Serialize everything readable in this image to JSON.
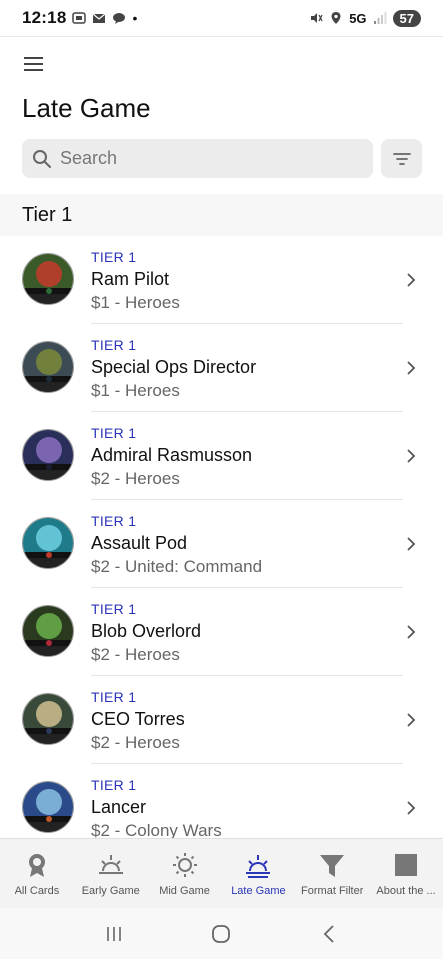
{
  "status_bar": {
    "time": "12:18",
    "network": "5G",
    "battery": "57"
  },
  "header": {
    "title": "Late Game",
    "search_placeholder": "Search"
  },
  "section": {
    "title": "Tier 1"
  },
  "cards": [
    {
      "tier": "TIER 1",
      "name": "Ram Pilot",
      "sub": "$1 - Heroes",
      "colors": [
        "#3a5a2a",
        "#c43b2a",
        "#2d6b3a"
      ]
    },
    {
      "tier": "TIER 1",
      "name": "Special Ops Director",
      "sub": "$1 - Heroes",
      "colors": [
        "#3d4b55",
        "#7b8a3a",
        "#1f2f3a"
      ]
    },
    {
      "tier": "TIER 1",
      "name": "Admiral Rasmusson",
      "sub": "$2 - Heroes",
      "colors": [
        "#2a2f5a",
        "#8b6fc0",
        "#1c1f33"
      ]
    },
    {
      "tier": "TIER 1",
      "name": "Assault Pod",
      "sub": "$2 - United: Command",
      "colors": [
        "#1f7a8a",
        "#6fd0e0",
        "#c03a2a"
      ]
    },
    {
      "tier": "TIER 1",
      "name": "Blob Overlord",
      "sub": "$2 - Heroes",
      "colors": [
        "#2a3a1f",
        "#6ab04a",
        "#b02a3a"
      ]
    },
    {
      "tier": "TIER 1",
      "name": "CEO Torres",
      "sub": "$2 - Heroes",
      "colors": [
        "#3a4a3a",
        "#d0c090",
        "#2a3a5a"
      ]
    },
    {
      "tier": "TIER 1",
      "name": "Lancer",
      "sub": "$2 - Colony Wars",
      "colors": [
        "#2a4a8a",
        "#8ac0e0",
        "#c05a2a"
      ]
    }
  ],
  "tabs": [
    {
      "label": "All Cards",
      "icon": "badge-icon",
      "active": false
    },
    {
      "label": "Early Game",
      "icon": "sunrise-icon",
      "active": false
    },
    {
      "label": "Mid Game",
      "icon": "sun-icon",
      "active": false
    },
    {
      "label": "Late Game",
      "icon": "sunset-icon",
      "active": true
    },
    {
      "label": "Format Filter",
      "icon": "funnel-icon",
      "active": false
    },
    {
      "label": "About the ...",
      "icon": "square-icon",
      "active": false
    }
  ],
  "colors": {
    "accent": "#2a35b8",
    "muted": "#666666"
  }
}
